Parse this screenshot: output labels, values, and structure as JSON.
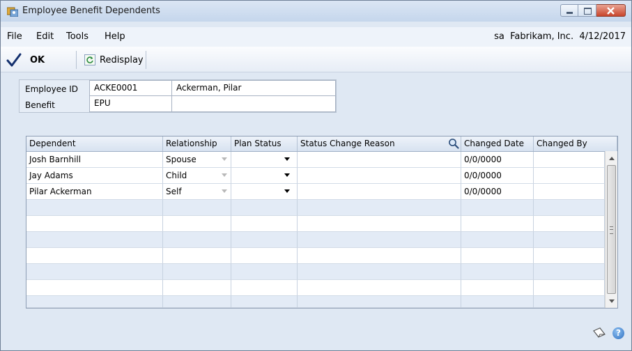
{
  "window": {
    "title": "Employee Benefit Dependents"
  },
  "menu": {
    "items": [
      "File",
      "Edit",
      "Tools",
      "Help"
    ],
    "company_info": "sa  Fabrikam, Inc.  4/12/2017"
  },
  "toolbar": {
    "ok_label": "OK",
    "redisplay_label": "Redisplay"
  },
  "header_fields": {
    "employee_id_label": "Employee ID",
    "employee_id_value": "ACKE0001",
    "employee_name": "Ackerman, Pilar",
    "benefit_label": "Benefit",
    "benefit_value": "EPU",
    "benefit_description": ""
  },
  "grid": {
    "columns": [
      "Dependent",
      "Relationship",
      "Plan Status",
      "Status Change Reason",
      "Changed Date",
      "Changed By"
    ],
    "rows": [
      {
        "dependent": "Josh Barnhill",
        "relationship": "Spouse",
        "plan_status": "",
        "status_change_reason": "",
        "changed_date": "0/0/0000",
        "changed_by": ""
      },
      {
        "dependent": "Jay Adams",
        "relationship": "Child",
        "plan_status": "",
        "status_change_reason": "",
        "changed_date": "0/0/0000",
        "changed_by": ""
      },
      {
        "dependent": "Pilar Ackerman",
        "relationship": "Self",
        "plan_status": "",
        "status_change_reason": "",
        "changed_date": "0/0/0000",
        "changed_by": ""
      }
    ]
  },
  "footer": {
    "help_glyph": "?"
  },
  "icons": [
    "app-icon",
    "checkmark-icon",
    "refresh-icon",
    "lookup-magnifier-icon",
    "note-icon",
    "help-icon"
  ],
  "colors": {
    "window_bg": "#dfe8f3",
    "alt_row": "#e3ebf6",
    "close_button": "#c9452c",
    "ok_check": "#14306e"
  }
}
